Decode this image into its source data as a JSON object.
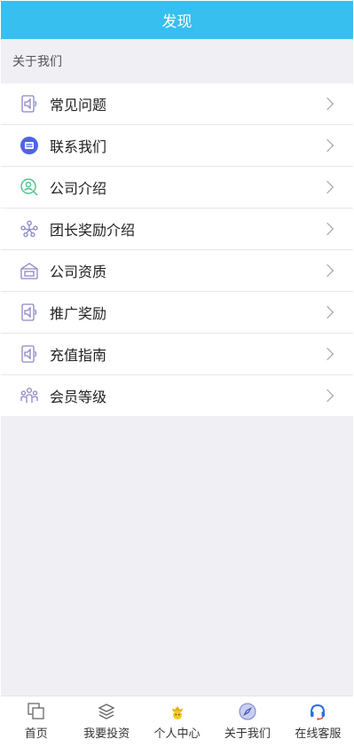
{
  "header": {
    "title": "发现"
  },
  "section": {
    "label": "关于我们"
  },
  "menu": {
    "items": [
      {
        "label": "常见问题",
        "icon": "speaker-doc-icon"
      },
      {
        "label": "联系我们",
        "icon": "contact-badge-icon"
      },
      {
        "label": "公司介绍",
        "icon": "user-search-icon"
      },
      {
        "label": "团长奖励介绍",
        "icon": "team-network-icon"
      },
      {
        "label": "公司资质",
        "icon": "certificate-box-icon"
      },
      {
        "label": "推广奖励",
        "icon": "speaker-doc-icon"
      },
      {
        "label": "充值指南",
        "icon": "speaker-doc-icon"
      },
      {
        "label": "会员等级",
        "icon": "members-icon"
      }
    ]
  },
  "tabbar": {
    "items": [
      {
        "label": "首页",
        "icon": "home-squares-icon"
      },
      {
        "label": "我要投资",
        "icon": "layers-icon"
      },
      {
        "label": "个人中心",
        "icon": "crown-user-icon"
      },
      {
        "label": "关于我们",
        "icon": "compass-icon"
      },
      {
        "label": "在线客服",
        "icon": "headset-icon"
      }
    ]
  },
  "colors": {
    "header_bg": "#36bfef",
    "page_bg": "#efeff4",
    "icon_purple": "#8a86c6",
    "icon_green": "#4cc38a",
    "contact_blue": "#4f63e6"
  }
}
